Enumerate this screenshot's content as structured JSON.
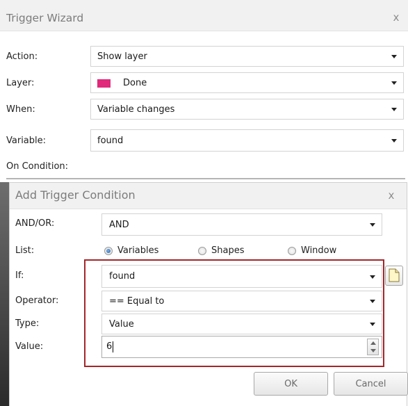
{
  "trigger_wizard": {
    "title": "Trigger Wizard",
    "close": "x",
    "action_label": "Action:",
    "action_value": "Show layer",
    "layer_label": "Layer:",
    "layer_value": "Done",
    "layer_color": "#e0297a",
    "when_label": "When:",
    "when_value": "Variable changes",
    "variable_label": "Variable:",
    "variable_value": "found",
    "on_condition_label": "On Condition:"
  },
  "add_trigger_condition": {
    "title": "Add Trigger Condition",
    "close": "x",
    "andor_label": "AND/OR:",
    "andor_value": "AND",
    "list_label": "List:",
    "list_options": [
      "Variables",
      "Shapes",
      "Window"
    ],
    "list_selected": "Variables",
    "if_label": "If:",
    "if_value": "found",
    "operator_label": "Operator:",
    "operator_value": "== Equal to",
    "type_label": "Type:",
    "type_value": "Value",
    "value_label": "Value:",
    "value_value": "6",
    "ok_label": "OK",
    "cancel_label": "Cancel",
    "highlight_color": "#a3262a"
  }
}
